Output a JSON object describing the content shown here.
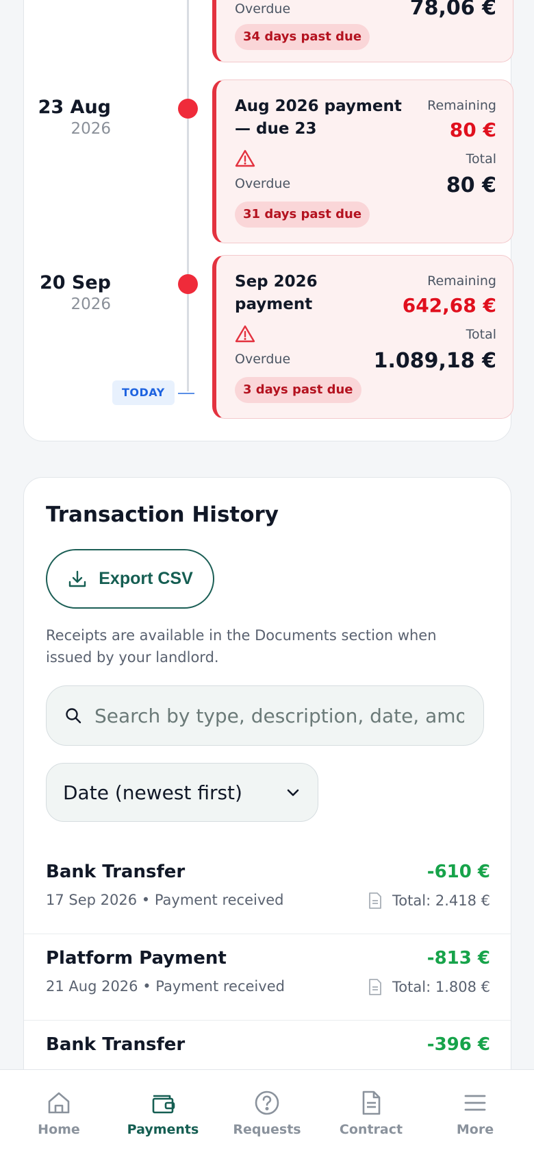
{
  "timeline": {
    "items": [
      {
        "overdue_label": "Overdue",
        "total_amount": "78,06 €",
        "past_due": "34 days past due"
      },
      {
        "day": "23 Aug",
        "year": "2026",
        "title": "Aug 2026 payment — due 23",
        "warning_icon": "warning-triangle-icon",
        "overdue_label": "Overdue",
        "past_due": "31 days past due",
        "remaining_label": "Remaining",
        "remaining_amount": "80 €",
        "total_label": "Total",
        "total_amount": "80 €"
      },
      {
        "day": "20 Sep",
        "year": "2026",
        "title": "Sep 2026 payment",
        "warning_icon": "warning-triangle-icon",
        "overdue_label": "Overdue",
        "past_due": "3 days past due",
        "remaining_label": "Remaining",
        "remaining_amount": "642,68 €",
        "total_label": "Total",
        "total_amount": "1.089,18 €"
      }
    ],
    "today_label": "TODAY",
    "colors": {
      "overdue_accent": "#e3323f",
      "dot": "#ef2b3a",
      "today": "#1e63e0"
    }
  },
  "transactions": {
    "heading": "Transaction History",
    "export_label": "Export CSV",
    "export_icon": "download-icon",
    "note": "Receipts are available in the Documents section when issued by your landlord.",
    "search_placeholder": "Search by type, description, date, amount",
    "search_icon": "search-icon",
    "sort_value": "Date (newest first)",
    "rows": [
      {
        "type": "Bank Transfer",
        "meta": "17 Sep 2026 • Payment received",
        "amount": "-610 €",
        "total": "Total: 2.418 €"
      },
      {
        "type": "Platform Payment",
        "meta": "21 Aug 2026 • Payment received",
        "amount": "-813 €",
        "total": "Total: 1.808 €"
      },
      {
        "type": "Bank Transfer",
        "meta": "",
        "amount": "-396 €",
        "total": ""
      }
    ],
    "colors": {
      "amount": "#17a34a",
      "accent": "#155e52"
    }
  },
  "nav": {
    "items": [
      {
        "label": "Home",
        "icon": "home-icon"
      },
      {
        "label": "Payments",
        "icon": "wallet-icon",
        "active": true
      },
      {
        "label": "Requests",
        "icon": "help-circle-icon"
      },
      {
        "label": "Contract",
        "icon": "document-icon"
      },
      {
        "label": "More",
        "icon": "menu-icon"
      }
    ]
  }
}
